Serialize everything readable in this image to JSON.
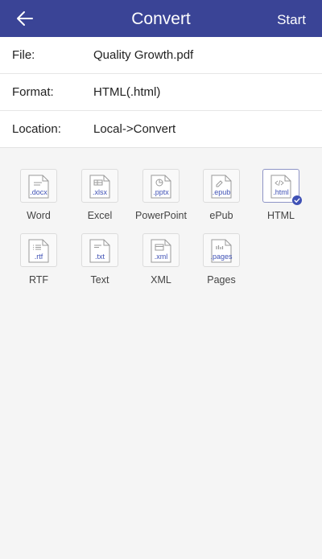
{
  "header": {
    "title": "Convert",
    "start_label": "Start"
  },
  "info": {
    "rows": [
      {
        "label": "File:",
        "value": "Quality Growth.pdf"
      },
      {
        "label": "Format:",
        "value": "HTML(.html)"
      },
      {
        "label": "Location:",
        "value": "Local->Convert"
      }
    ]
  },
  "formats": [
    {
      "name": "Word",
      "ext": ".docx",
      "icon": "lines-icon"
    },
    {
      "name": "Excel",
      "ext": ".xlsx",
      "icon": "table-icon"
    },
    {
      "name": "PowerPoint",
      "ext": ".pptx",
      "icon": "pie-icon"
    },
    {
      "name": "ePub",
      "ext": ".epub",
      "icon": "pen-icon"
    },
    {
      "name": "HTML",
      "ext": ".html",
      "icon": "code-icon",
      "selected": true
    },
    {
      "name": "RTF",
      "ext": ".rtf",
      "icon": "list-icon"
    },
    {
      "name": "Text",
      "ext": ".txt",
      "icon": "text-icon"
    },
    {
      "name": "XML",
      "ext": ".xml",
      "icon": "frame-icon"
    },
    {
      "name": "Pages",
      "ext": ".pages",
      "icon": "bars-icon"
    }
  ],
  "colors": {
    "accent": "#3a4496",
    "icon_accent": "#3f51b5"
  }
}
